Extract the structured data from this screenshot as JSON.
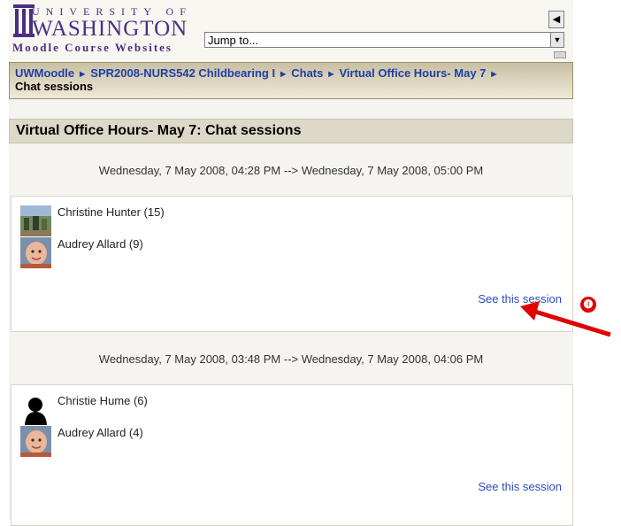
{
  "header": {
    "university": "UNIVERSITY OF",
    "name": "WASHINGTON",
    "subtitle": "Moodle Course Websites",
    "jump_value": "Jump to...",
    "nav_prev_icon": "triangle-left-icon"
  },
  "breadcrumb": {
    "items": [
      "UWMoodle",
      "SPR2008-NURS542 Childbearing I",
      "Chats",
      "Virtual Office Hours- May 7"
    ],
    "current": "Chat sessions",
    "separator": "►"
  },
  "page_title": "Virtual Office Hours- May 7: Chat sessions",
  "sessions": [
    {
      "time": "Wednesday, 7 May 2008, 04:28 PM --> Wednesday, 7 May 2008, 05:00 PM",
      "users": [
        {
          "name": "Christine Hunter (15)",
          "avatar": "photo-outdoor"
        },
        {
          "name": "Audrey Allard (9)",
          "avatar": "photo-baby"
        }
      ],
      "link": "See this session"
    },
    {
      "time": "Wednesday, 7 May 2008, 03:48 PM --> Wednesday, 7 May 2008, 04:06 PM",
      "users": [
        {
          "name": "Christie Hume (6)",
          "avatar": "silhouette"
        },
        {
          "name": "Audrey Allard (4)",
          "avatar": "photo-baby"
        }
      ],
      "link": "See this session"
    }
  ],
  "annotation": {
    "marker": "❹",
    "color": "#e00000"
  }
}
